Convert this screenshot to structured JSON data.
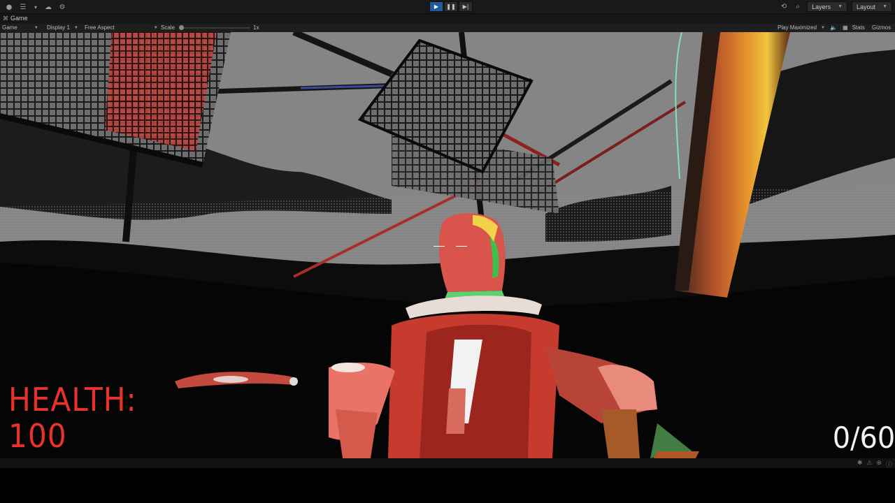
{
  "toolbar": {
    "left_icons": [
      "account-icon",
      "menu-icon",
      "cloud-icon",
      "settings-icon"
    ],
    "play_controls": [
      "play-icon",
      "pause-icon",
      "step-icon"
    ],
    "right": {
      "history_icon": "history-icon",
      "search_icon": "search-icon",
      "layers_label": "Layers",
      "layout_label": "Layout"
    }
  },
  "tab": {
    "label": "Game"
  },
  "gamebar": {
    "mode": "Game",
    "display": "Display 1",
    "aspect": "Free Aspect",
    "scale_label": "Scale",
    "scale_value": "1x",
    "play_mode": "Play Maximized",
    "stats_label": "Stats",
    "gizmos_label": "Gizmos"
  },
  "hud": {
    "health_label": "HEALTH:",
    "health_value": "100",
    "ammo": "0/60"
  },
  "colors": {
    "health": "#e8322c",
    "ammo": "#f2f2f2",
    "play_active": "#1e5a9c"
  }
}
